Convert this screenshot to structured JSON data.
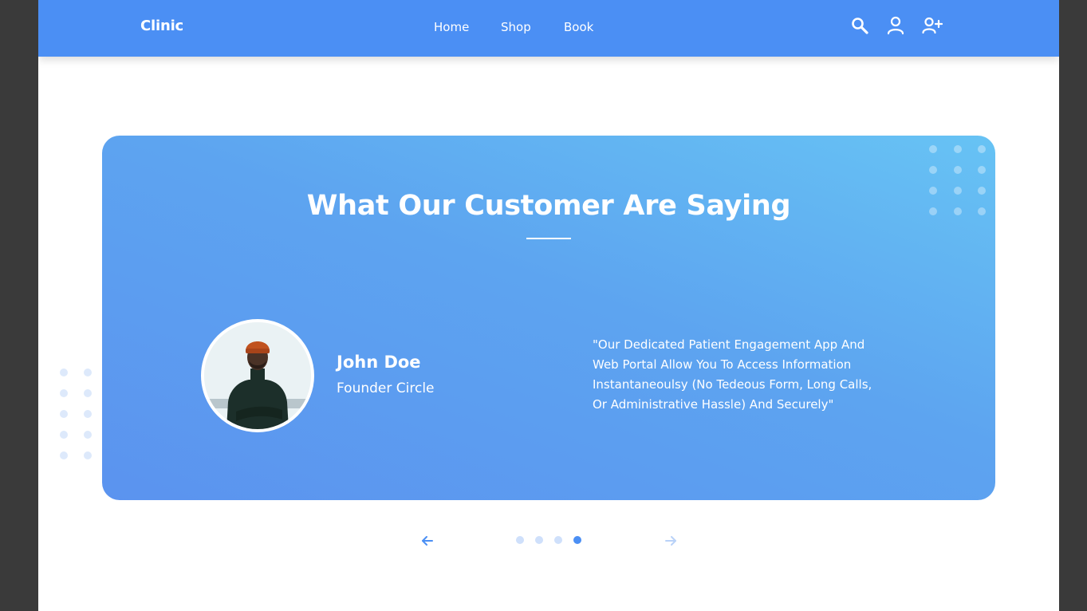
{
  "header": {
    "brand": "Clinic",
    "nav": [
      "Home",
      "Shop",
      "Book"
    ],
    "icons": [
      "search-icon",
      "user-icon",
      "user-add-icon"
    ]
  },
  "testimonial": {
    "title": "What Our Customer Are Saying",
    "name": "John Doe",
    "role": "Founder Circle",
    "quote_lines": [
      "\"Our Dedicated Patient Engagement App And",
      "Web Portal Allow You To Access Information",
      "Instantaneoulsy (No Tedeous Form, Long Calls,",
      "Or Administrative Hassle) And Securely\""
    ]
  },
  "slider": {
    "slide_count": 4,
    "active_index": 3,
    "prev_icon": "arrow-left-icon",
    "next_icon": "arrow-right-icon"
  },
  "colors": {
    "primary": "#4b8ff4",
    "card_gradient_start": "#67c3f4",
    "card_gradient_end": "#5b93ef",
    "dot_inactive": "#cfe0fb",
    "background_frame": "#3a3a3a"
  }
}
